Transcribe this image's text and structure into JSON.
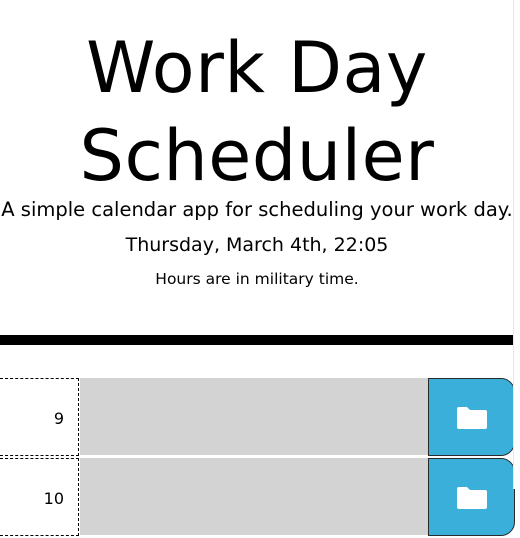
{
  "header": {
    "title": "Work Day Scheduler",
    "title_line1": "Work Day",
    "title_line2": "Scheduler",
    "lead": "A simple calendar app for scheduling your work day.",
    "current_day": "Thursday, March 4th, 22:05",
    "note": "Hours are in military time."
  },
  "time_blocks": [
    {
      "hour": "9",
      "description": "",
      "state": "past"
    },
    {
      "hour": "10",
      "description": "",
      "state": "past"
    }
  ],
  "icons": {
    "save": "folder-icon"
  },
  "colors": {
    "past": "#d3d3d3",
    "save_button": "#3aafda",
    "divider": "#000000"
  }
}
